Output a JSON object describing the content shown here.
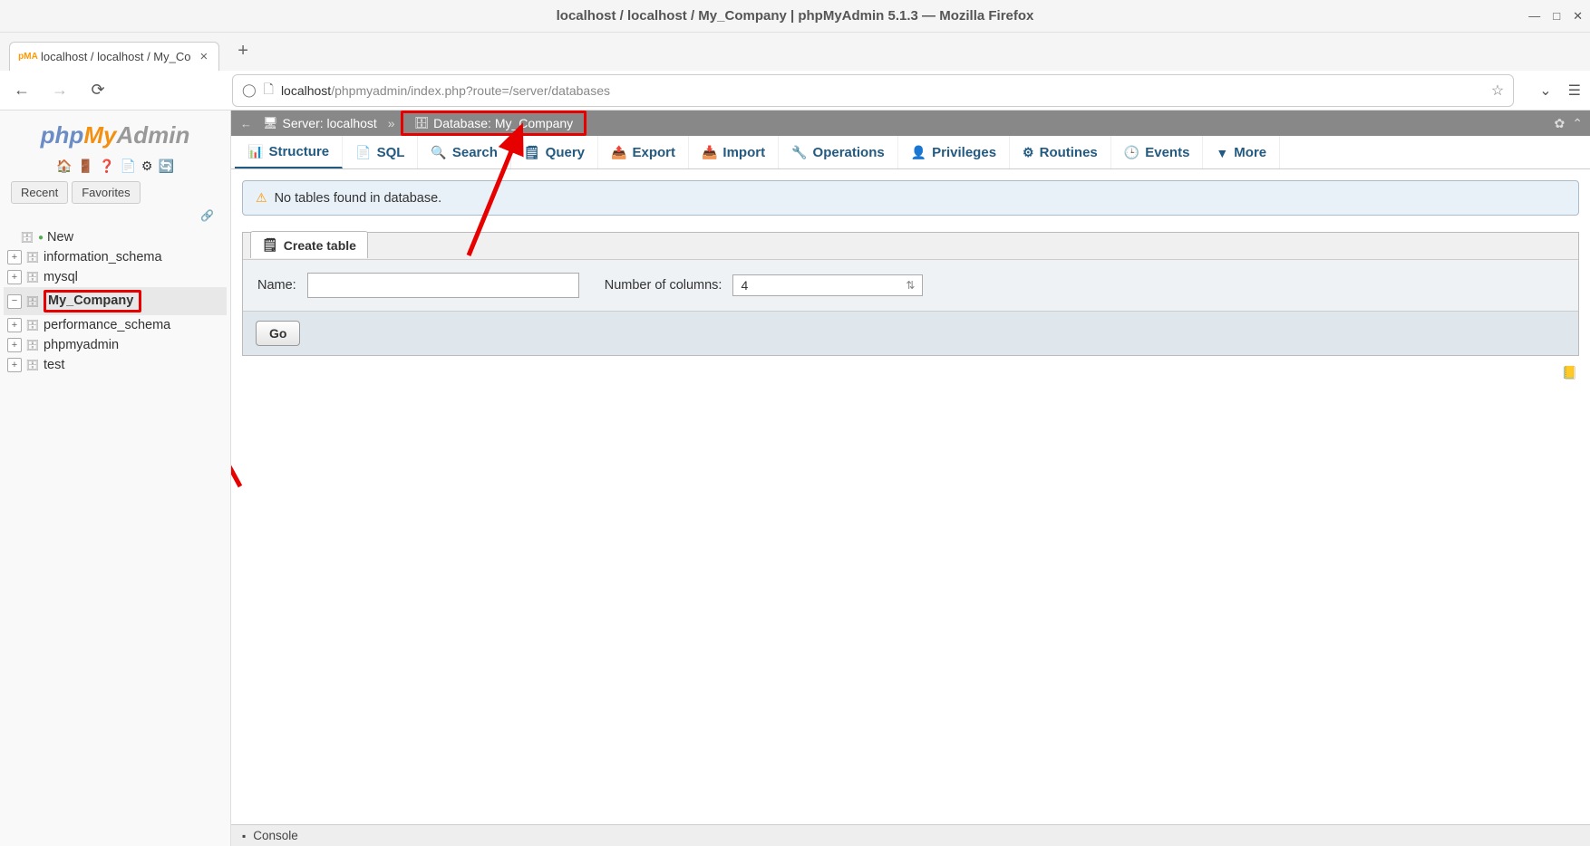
{
  "window": {
    "title": "localhost / localhost / My_Company | phpMyAdmin 5.1.3 — Mozilla Firefox"
  },
  "browser_tab": {
    "title": "localhost / localhost / My_Co",
    "favicon_text": "pMA"
  },
  "url": {
    "host": "localhost",
    "path": "/phpmyadmin/index.php?route=/server/databases"
  },
  "sidebar": {
    "logo": {
      "p1": "php",
      "p2": "My",
      "p3": "Admin"
    },
    "subtabs": {
      "recent": "Recent",
      "favorites": "Favorites"
    },
    "tree": {
      "new_label": "New",
      "databases": [
        {
          "label": "information_schema",
          "selected": false,
          "expanded": false
        },
        {
          "label": "mysql",
          "selected": false,
          "expanded": false
        },
        {
          "label": "My_Company",
          "selected": true,
          "expanded": true,
          "highlighted": true
        },
        {
          "label": "performance_schema",
          "selected": false,
          "expanded": false
        },
        {
          "label": "phpmyadmin",
          "selected": false,
          "expanded": false
        },
        {
          "label": "test",
          "selected": false,
          "expanded": false
        }
      ]
    }
  },
  "breadcrumb": {
    "server_label": "Server: localhost",
    "database_label": "Database: My_Company"
  },
  "tabs": [
    {
      "label": "Structure",
      "icon": "📊",
      "active": true
    },
    {
      "label": "SQL",
      "icon": "📄",
      "active": false
    },
    {
      "label": "Search",
      "icon": "🔍",
      "active": false
    },
    {
      "label": "Query",
      "icon": "🗒",
      "active": false
    },
    {
      "label": "Export",
      "icon": "📤",
      "active": false
    },
    {
      "label": "Import",
      "icon": "📥",
      "active": false
    },
    {
      "label": "Operations",
      "icon": "🔧",
      "active": false
    },
    {
      "label": "Privileges",
      "icon": "👤",
      "active": false
    },
    {
      "label": "Routines",
      "icon": "⚙",
      "active": false
    },
    {
      "label": "Events",
      "icon": "🕒",
      "active": false
    },
    {
      "label": "More",
      "icon": "▼",
      "active": false
    }
  ],
  "message": "No tables found in database.",
  "create_table": {
    "panel_title": "Create table",
    "name_label": "Name:",
    "name_value": "",
    "cols_label": "Number of columns:",
    "cols_value": "4",
    "go_label": "Go"
  },
  "console": {
    "label": "Console"
  }
}
